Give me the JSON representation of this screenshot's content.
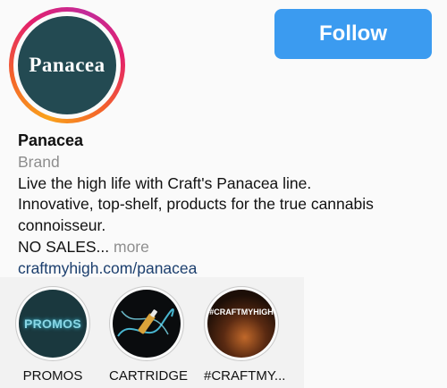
{
  "profile": {
    "logo_text": "Panacea",
    "follow_label": "Follow",
    "name": "Panacea",
    "category": "Brand",
    "bio_lines": [
      "Live the high life with Craft's Panacea line.",
      "Innovative, top-shelf, products for the true cannabis",
      "connoisseur."
    ],
    "bio_truncated": "NO SALES...",
    "more_label": "more",
    "link": "craftmyhigh.com/panacea"
  },
  "highlights": [
    {
      "label": "PROMOS",
      "cover_text": "PROMOS"
    },
    {
      "label": "CARTRIDGE"
    },
    {
      "label": "#CRAFTMY...",
      "cover_text": "#CRAFTMYHIGH"
    }
  ],
  "colors": {
    "follow_button": "#3b9bf0",
    "link": "#1c3f6e",
    "avatar_bg": "#234a52",
    "secondary_text": "#8e8e8e"
  }
}
